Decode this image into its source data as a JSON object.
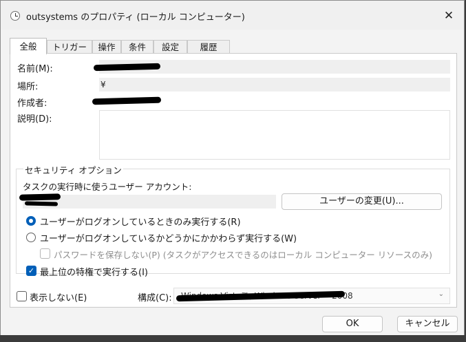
{
  "window": {
    "title": "outsystems のプロパティ (ローカル コンピューター)",
    "close_glyph": "✕"
  },
  "tabs": [
    {
      "label": "全般",
      "active": true
    },
    {
      "label": "トリガー"
    },
    {
      "label": "操作"
    },
    {
      "label": "条件"
    },
    {
      "label": "設定"
    },
    {
      "label": "履歴"
    }
  ],
  "general": {
    "name_label": "名前(M):",
    "location_label": "場所:",
    "location_value": "¥",
    "author_label": "作成者:",
    "description_label": "説明(D):"
  },
  "security": {
    "group_title": "セキュリティ オプション",
    "account_label": "タスクの実行時に使うユーザー アカウント:",
    "change_user_button": "ユーザーの変更(U)...",
    "radio_logged_on": "ユーザーがログオンしているときのみ実行する(R)",
    "radio_whether": "ユーザーがログオンしているかどうかにかかわらず実行する(W)",
    "no_store_password": "パスワードを保存しない(P) (タスクがアクセスできるのはローカル コンピューター リソースのみ)",
    "highest_privileges": "最上位の特権で実行する(I)"
  },
  "footer": {
    "hidden_label": "表示しない(E)",
    "config_label": "構成(C):",
    "config_value": "Windows Vista™, Windows Server™ 2008",
    "ok_button": "OK",
    "cancel_button": "キャンセル"
  },
  "icons": {
    "check": "✓",
    "dropdown": "⌄"
  },
  "colors": {
    "accent": "#005fb8",
    "panel_bg": "#ffffff",
    "window_bg": "#f3f3f3"
  }
}
